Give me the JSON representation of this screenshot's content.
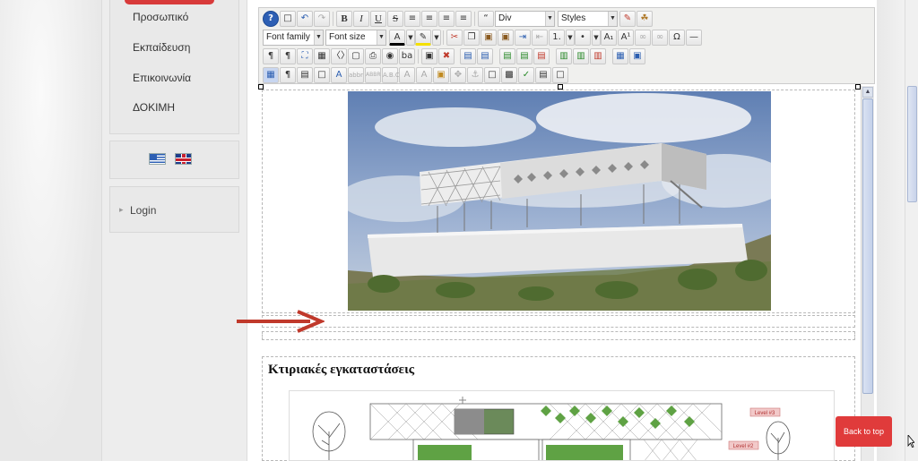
{
  "sidebar": {
    "menu": [
      {
        "label": "Προσωπικό"
      },
      {
        "label": "Εκπαίδευση"
      },
      {
        "label": "Επικοινωνία"
      },
      {
        "label": "ΔΟΚΙΜΗ"
      }
    ],
    "languages": [
      {
        "name": "greek-flag",
        "title": "Ελληνικά"
      },
      {
        "name": "uk-flag",
        "title": "English"
      }
    ],
    "login_label": "Login"
  },
  "toolbar": {
    "format_value": "Div",
    "styles_value": "Styles",
    "font_family_value": "Font family",
    "font_size_value": "Font size",
    "icons": {
      "help": "help-icon",
      "new_document": "new-document-icon",
      "undo": "undo-icon",
      "redo": "redo-icon",
      "bold": "B",
      "italic": "I",
      "underline": "U",
      "strikethrough": "S",
      "blockquote": "blockquote-icon"
    }
  },
  "content": {
    "section_title": "Κτιριακές εγκαταστάσεις",
    "plan_labels": [
      "Level #3",
      "Level #2"
    ]
  },
  "back_to_top": "Back to top",
  "colors": {
    "accent_red": "#e03b3b",
    "sidebar_bg": "#ededed",
    "arrow_red": "#c0392b"
  }
}
